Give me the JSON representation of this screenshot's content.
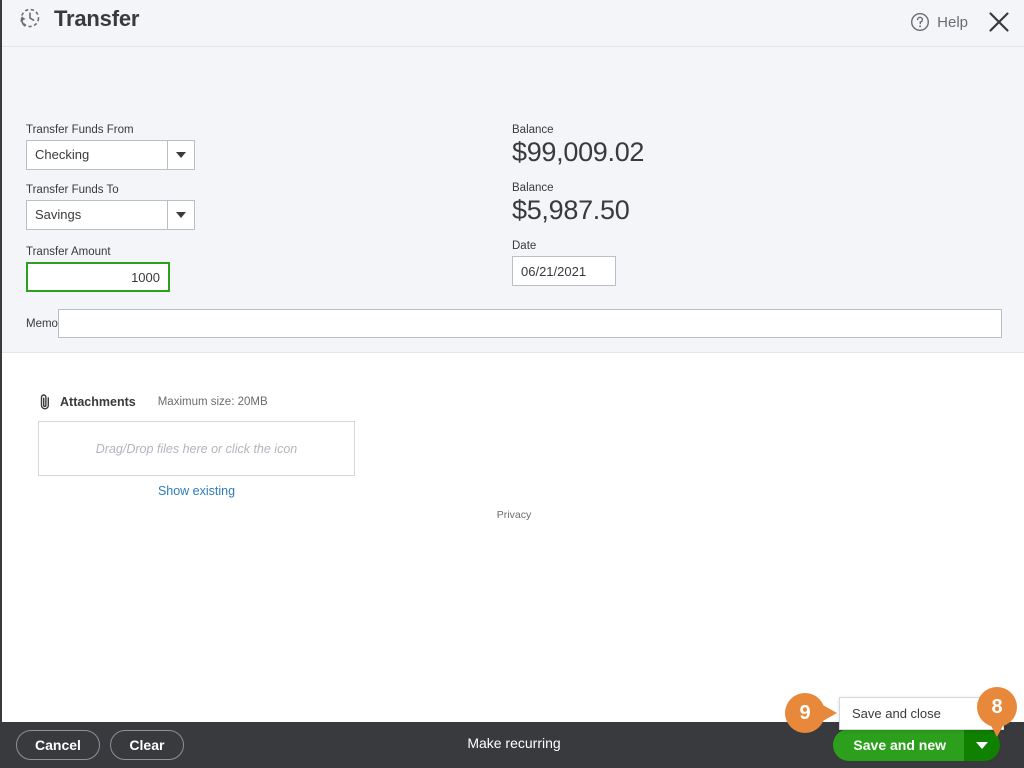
{
  "header": {
    "title": "Transfer",
    "recurring_icon": "recurring-clock-icon",
    "help_label": "Help",
    "help_icon": "question-circle-icon",
    "close_icon": "close-x-icon"
  },
  "form": {
    "transfer_from": {
      "label": "Transfer Funds From",
      "value": "Checking",
      "balance_label": "Balance",
      "balance_value": "$99,009.02"
    },
    "transfer_to": {
      "label": "Transfer Funds To",
      "value": "Savings",
      "balance_label": "Balance",
      "balance_value": "$5,987.50"
    },
    "transfer_amount": {
      "label": "Transfer Amount",
      "value": "1000",
      "placeholder": ""
    },
    "date": {
      "label": "Date",
      "value": "06/21/2021",
      "placeholder": ""
    },
    "memo": {
      "label": "Memo",
      "value": "",
      "placeholder": ""
    }
  },
  "attachments": {
    "icon": "paperclip-icon",
    "title": "Attachments",
    "max_size": "Maximum size: 20MB",
    "dropzone_text": "Drag/Drop files here or click the icon",
    "show_existing": "Show existing"
  },
  "privacy": "Privacy",
  "footer": {
    "cancel": "Cancel",
    "clear": "Clear",
    "make_recurring": "Make recurring",
    "save_and_new": "Save and new",
    "save_caret_icon": "chevron-down-icon"
  },
  "save_menu": {
    "items": [
      {
        "label": "Save and close"
      }
    ]
  },
  "callouts": [
    {
      "number": "9",
      "points": "right"
    },
    {
      "number": "8",
      "points": "down"
    }
  ],
  "colors": {
    "accent_green": "#2ca01c",
    "accent_green_dark": "#108000",
    "callout_orange": "#e8883a",
    "link_blue": "#2d7bbd",
    "panel_gray": "#f4f5f8",
    "footer_dark": "#393a3d"
  }
}
